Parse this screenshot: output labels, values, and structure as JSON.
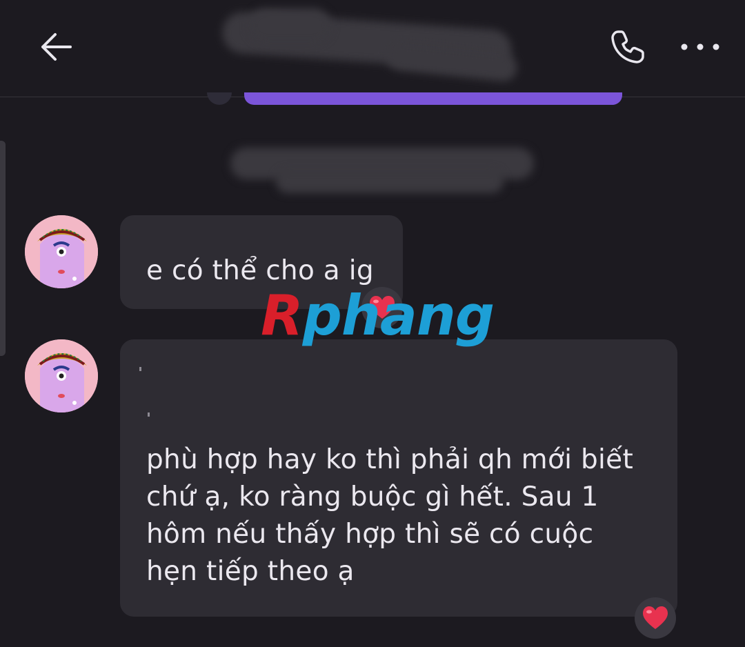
{
  "header": {
    "back_icon": "arrow-left-icon",
    "call_icon": "phone-icon",
    "more_icon": "more-horizontal-icon"
  },
  "messages": [
    {
      "text": "e có thể cho a ig",
      "reaction": "heart-icon"
    },
    {
      "text": "phù hợp hay ko thì phải qh mới biết\nchứ ạ, ko ràng buộc gì hết. Sau 1\nhôm nếu thấy hợp thì sẽ có cuộc\nhẹn tiếp theo ạ",
      "reaction": "heart-icon"
    }
  ],
  "watermark": {
    "first": "R",
    "rest": "phang"
  },
  "colors": {
    "background": "#1c1a20",
    "bubble": "#2e2c33",
    "accent_purple": "#7b55d9",
    "heart": "#e8324f",
    "watermark_red": "#d91f2a",
    "watermark_blue": "#1d9fd6"
  }
}
